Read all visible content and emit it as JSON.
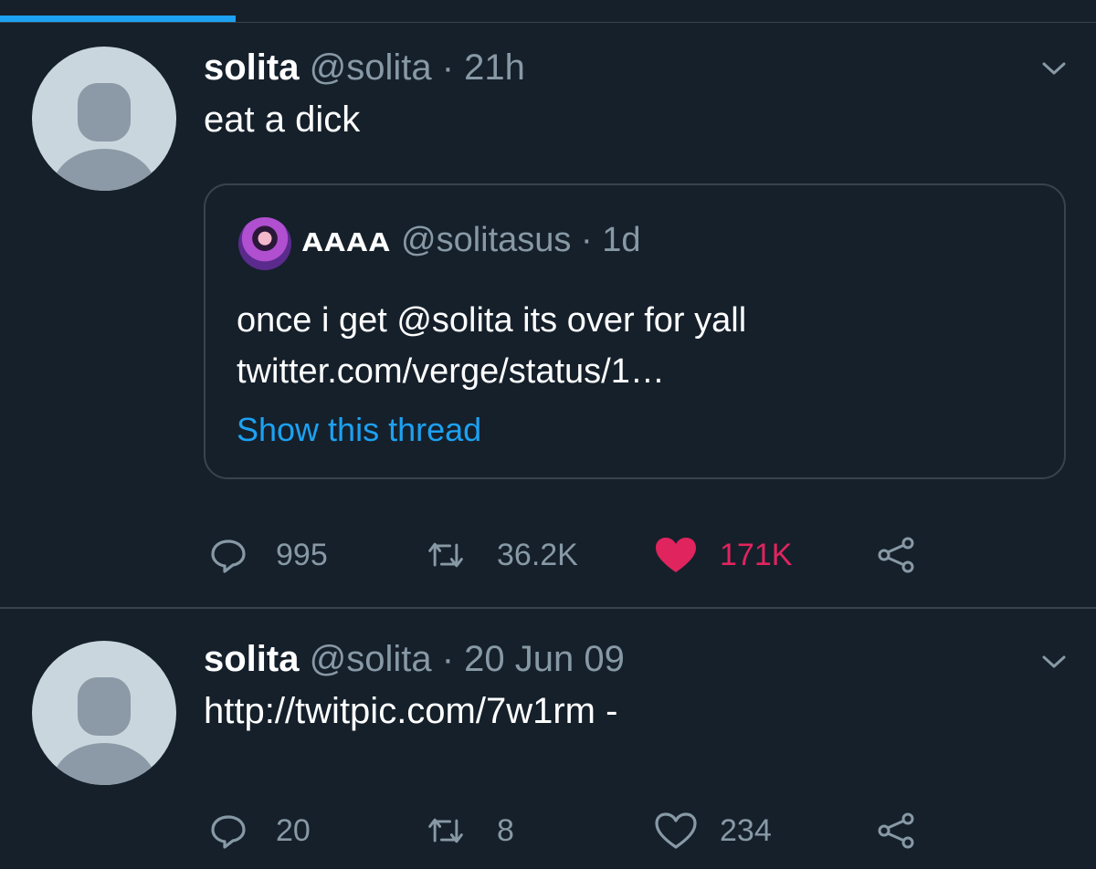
{
  "colors": {
    "background": "#15202b",
    "border": "#38444d",
    "muted": "#8899a6",
    "link": "#1da1f2",
    "like": "#e0245e"
  },
  "icons": [
    "chevron-down-icon",
    "reply-icon",
    "retweet-icon",
    "heart-icon",
    "share-icon",
    "default-avatar-icon"
  ],
  "tweets": [
    {
      "name": "solita",
      "handle": "@solita",
      "dot": "·",
      "time": "21h",
      "text": "eat a dick",
      "quote": {
        "name": "ᴀᴀᴀᴀ",
        "handle": "@solitasus",
        "dot": "·",
        "time": "1d",
        "line1": "once i get @solita its over for yall",
        "line2": "twitter.com/verge/status/1…",
        "show_thread": "Show this thread"
      },
      "replies": "995",
      "retweets": "36.2K",
      "likes": "171K",
      "liked": true
    },
    {
      "name": "solita",
      "handle": "@solita",
      "dot": "·",
      "time": "20 Jun 09",
      "text": "http://twitpic.com/7w1rm -",
      "replies": "20",
      "retweets": "8",
      "likes": "234",
      "liked": false
    }
  ]
}
